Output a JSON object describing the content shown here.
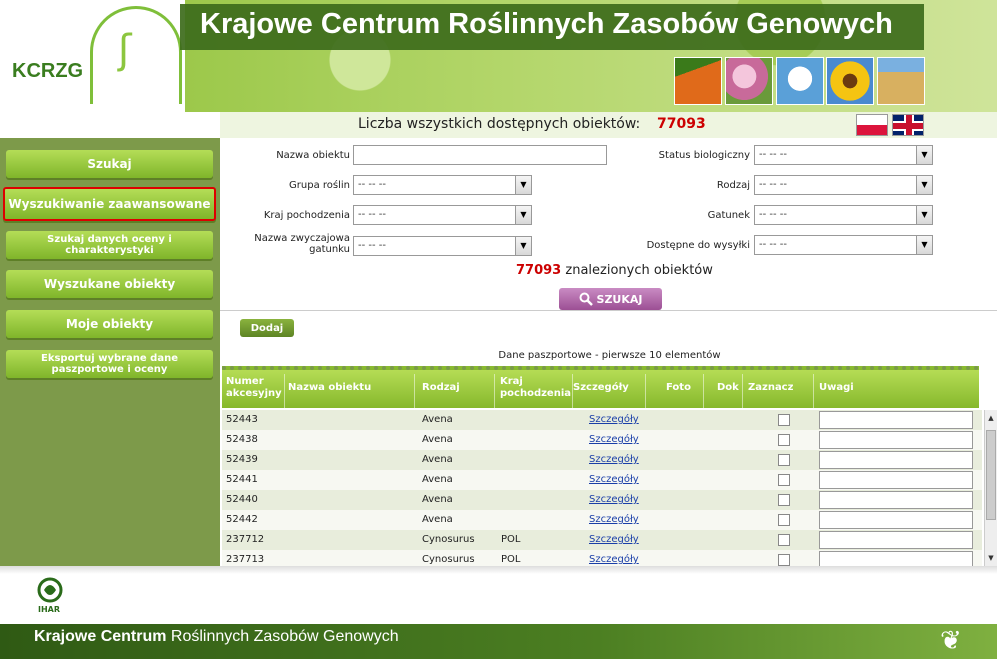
{
  "header": {
    "logo_text": "KCRZG",
    "site_title": "Krajowe Centrum Roślinnych Zasobów Genowych",
    "count_label": "Liczba wszystkich dostępnych obiektów:",
    "count_value": "77093"
  },
  "sidebar": {
    "items": [
      {
        "label": "Szukaj"
      },
      {
        "label": "Wyszukiwanie zaawansowane"
      },
      {
        "label": "Szukaj danych oceny i charakterystyki"
      },
      {
        "label": "Wyszukane obiekty"
      },
      {
        "label": "Moje obiekty"
      },
      {
        "label": "Eksportuj wybrane dane paszportowe i oceny"
      }
    ]
  },
  "form": {
    "nazwa_obiektu_label": "Nazwa obiektu",
    "nazwa_obiektu_value": "",
    "grupa_roslin_label": "Grupa roślin",
    "kraj_label": "Kraj pochodzenia",
    "nazwa_zwyczajowa_label": "Nazwa zwyczajowa gatunku",
    "status_label": "Status biologiczny",
    "rodzaj_label": "Rodzaj",
    "gatunek_label": "Gatunek",
    "dostepne_label": "Dostępne do wysyłki",
    "select_default": "-- -- --",
    "found_count": "77093",
    "found_label": "znalezionych obiektów",
    "search_label": "SZUKAJ",
    "add_label": "Dodaj"
  },
  "table": {
    "caption": "Dane paszportowe - pierwsze 10 elementów",
    "headers": {
      "numer": "Numer akcesyjny",
      "nazwa": "Nazwa obiektu",
      "rodzaj": "Rodzaj",
      "kraj": "Kraj pochodzenia",
      "szczegoly": "Szczegóły",
      "foto": "Foto",
      "dok": "Dok",
      "zaznacz": "Zaznacz",
      "uwagi": "Uwagi"
    },
    "link_label": "Szczegóły",
    "rows": [
      {
        "numer": "52443",
        "rodzaj": "Avena",
        "kraj": ""
      },
      {
        "numer": "52438",
        "rodzaj": "Avena",
        "kraj": ""
      },
      {
        "numer": "52439",
        "rodzaj": "Avena",
        "kraj": ""
      },
      {
        "numer": "52441",
        "rodzaj": "Avena",
        "kraj": ""
      },
      {
        "numer": "52440",
        "rodzaj": "Avena",
        "kraj": ""
      },
      {
        "numer": "52442",
        "rodzaj": "Avena",
        "kraj": ""
      },
      {
        "numer": "237712",
        "rodzaj": "Cynosurus",
        "kraj": "POL"
      },
      {
        "numer": "237713",
        "rodzaj": "Cynosurus",
        "kraj": "POL"
      }
    ]
  },
  "footer": {
    "title_bold": "Krajowe Centrum",
    "title_rest": "Roślinnych Zasobów Genowych",
    "ihar": "IHAR"
  },
  "colors": {
    "accent_green": "#86b82c",
    "dark_green": "#3d6b1b",
    "count_red": "#cc0000",
    "search_purple": "#9c4f94"
  }
}
